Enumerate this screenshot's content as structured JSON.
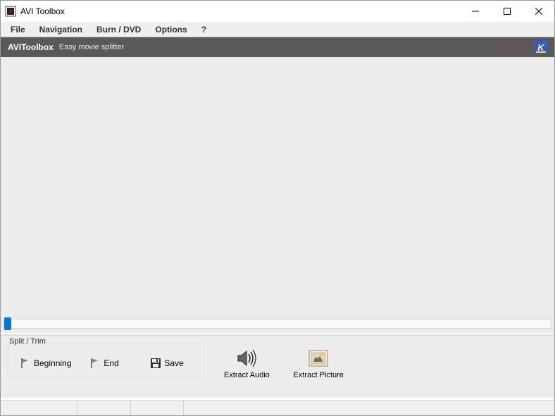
{
  "window": {
    "title": "AVI Toolbox"
  },
  "menu": {
    "file": "File",
    "navigation": "Navigation",
    "burn": "Burn / DVD",
    "options": "Options",
    "help": "?"
  },
  "banner": {
    "title": "AVIToolbox",
    "subtitle": "Easy movie splitter"
  },
  "group": {
    "label": "Split / Trim",
    "beginning": "Beginning",
    "end": "End",
    "save": "Save"
  },
  "actions": {
    "extract_audio": "Extract Audio",
    "extract_picture": "Extract Picture"
  },
  "watermark": "Komputer"
}
